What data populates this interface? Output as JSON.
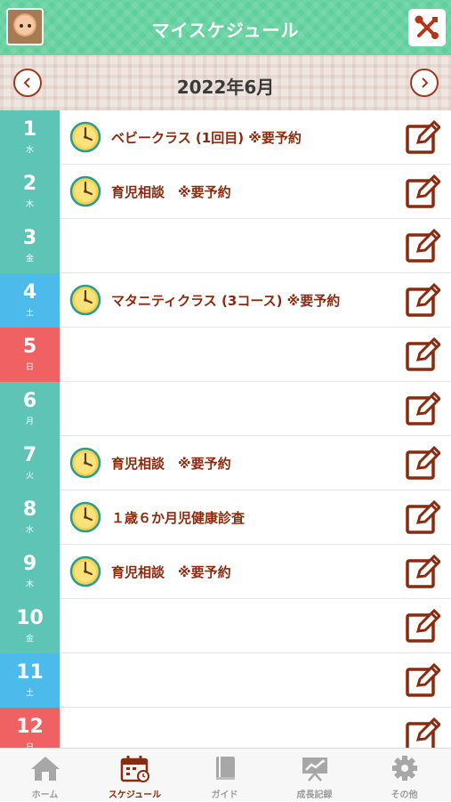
{
  "header": {
    "title": "マイスケジュール"
  },
  "month": {
    "label": "2022年6月"
  },
  "colors": {
    "weekday": "#5ec4b6",
    "saturday": "#4cbbeb",
    "sunday": "#ef6163",
    "accent": "#8a2a0e",
    "header": "#5fcf9c"
  },
  "days": [
    {
      "num": "1",
      "dow": "水",
      "type": "weekday",
      "event": "ベビークラス (1回目) ※要予約"
    },
    {
      "num": "2",
      "dow": "木",
      "type": "weekday",
      "event": "育児相談　※要予約"
    },
    {
      "num": "3",
      "dow": "金",
      "type": "weekday",
      "event": ""
    },
    {
      "num": "4",
      "dow": "土",
      "type": "saturday",
      "event": "マタニティクラス (3コース) ※要予約"
    },
    {
      "num": "5",
      "dow": "日",
      "type": "sunday",
      "event": ""
    },
    {
      "num": "6",
      "dow": "月",
      "type": "weekday",
      "event": ""
    },
    {
      "num": "7",
      "dow": "火",
      "type": "weekday",
      "event": "育児相談　※要予約"
    },
    {
      "num": "8",
      "dow": "水",
      "type": "weekday",
      "event": "１歳６か月児健康診査"
    },
    {
      "num": "9",
      "dow": "木",
      "type": "weekday",
      "event": "育児相談　※要予約"
    },
    {
      "num": "10",
      "dow": "金",
      "type": "weekday",
      "event": ""
    },
    {
      "num": "11",
      "dow": "土",
      "type": "saturday",
      "event": ""
    },
    {
      "num": "12",
      "dow": "日",
      "type": "sunday",
      "event": ""
    }
  ],
  "tabs": [
    {
      "label": "ホーム",
      "icon": "home-icon",
      "active": false
    },
    {
      "label": "スケジュール",
      "icon": "calendar-icon",
      "active": true
    },
    {
      "label": "ガイド",
      "icon": "book-icon",
      "active": false
    },
    {
      "label": "成長記録",
      "icon": "growth-record-icon",
      "active": false
    },
    {
      "label": "その他",
      "icon": "gear-icon",
      "active": false
    }
  ]
}
